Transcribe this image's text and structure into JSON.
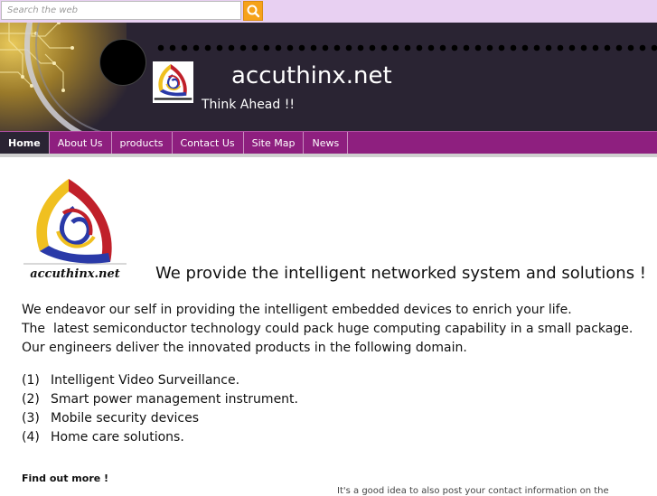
{
  "search": {
    "placeholder": "Search the web",
    "button_icon": "search-icon"
  },
  "header": {
    "title": "accuthinx.net",
    "tagline": "Think Ahead !!",
    "logo_text": "accuthinx.net",
    "background_color": "#2a2433"
  },
  "nav": {
    "accent_color": "#8e1f7f",
    "items": [
      {
        "label": "Home",
        "active": true
      },
      {
        "label": "About Us"
      },
      {
        "label": "products"
      },
      {
        "label": "Contact Us"
      },
      {
        "label": "Site Map"
      },
      {
        "label": "News"
      }
    ]
  },
  "main": {
    "logo_text": "accuthinx.net",
    "headline": "We provide the intelligent networked system and solutions !",
    "paragraph": [
      "We endeavor our self in providing the intelligent embedded devices to enrich your life.",
      "The  latest semiconductor technology could pack huge computing capability in a small package.",
      "Our engineers deliver the innovated products in the following domain."
    ],
    "domains": [
      {
        "num": "(1)",
        "text": "Intelligent Video Surveillance."
      },
      {
        "num": "(2)",
        "text": "Smart power management instrument."
      },
      {
        "num": "(3)",
        "text": "Mobile security devices"
      },
      {
        "num": "(4)",
        "text": "Home care solutions."
      }
    ],
    "find_out_more": "Find out more !",
    "cutoff_text": "It's a good idea to also post your contact information on the"
  }
}
